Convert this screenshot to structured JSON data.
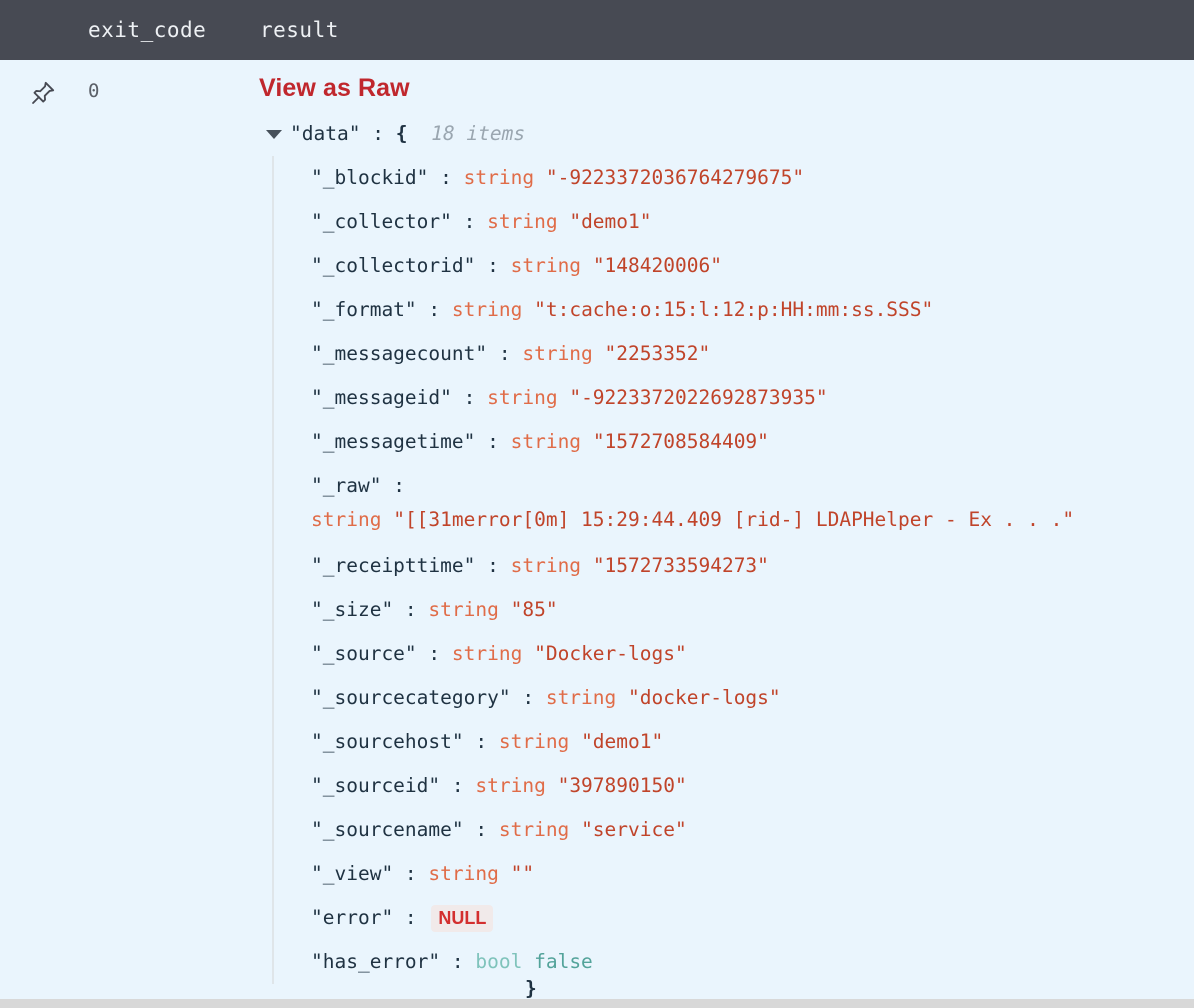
{
  "table": {
    "columns": [
      {
        "key": "pin",
        "label": ""
      },
      {
        "key": "exit_code",
        "label": "exit_code"
      },
      {
        "key": "result",
        "label": "result"
      }
    ],
    "row": {
      "pin_icon": "pushpin-icon",
      "exit_code": "0"
    }
  },
  "result": {
    "view_raw_label": "View as Raw",
    "root": {
      "key": "\"data\"",
      "colon": ":",
      "open_brace": "{",
      "count": "18 items",
      "close_brace": "}"
    },
    "fields": [
      {
        "key": "\"_blockid\"",
        "type": "string",
        "value": "\"-9223372036764279675\""
      },
      {
        "key": "\"_collector\"",
        "type": "string",
        "value": "\"demo1\""
      },
      {
        "key": "\"_collectorid\"",
        "type": "string",
        "value": "\"148420006\""
      },
      {
        "key": "\"_format\"",
        "type": "string",
        "value": "\"t:cache:o:15:l:12:p:HH:mm:ss.SSS\""
      },
      {
        "key": "\"_messagecount\"",
        "type": "string",
        "value": "\"2253352\""
      },
      {
        "key": "\"_messageid\"",
        "type": "string",
        "value": "\"-9223372022692873935\""
      },
      {
        "key": "\"_messagetime\"",
        "type": "string",
        "value": "\"1572708584409\""
      },
      {
        "key": "\"_raw\"",
        "type": "string",
        "value": "\"[[31merror[0m] 15:29:44.409 [rid-] LDAPHelper - Ex  . . .\""
      },
      {
        "key": "\"_receipttime\"",
        "type": "string",
        "value": "\"1572733594273\""
      },
      {
        "key": "\"_size\"",
        "type": "string",
        "value": "\"85\""
      },
      {
        "key": "\"_source\"",
        "type": "string",
        "value": "\"Docker-logs\""
      },
      {
        "key": "\"_sourcecategory\"",
        "type": "string",
        "value": "\"docker-logs\""
      },
      {
        "key": "\"_sourcehost\"",
        "type": "string",
        "value": "\"demo1\""
      },
      {
        "key": "\"_sourceid\"",
        "type": "string",
        "value": "\"397890150\""
      },
      {
        "key": "\"_sourcename\"",
        "type": "string",
        "value": "\"service\""
      },
      {
        "key": "\"_view\"",
        "type": "string",
        "value": "\"\""
      },
      {
        "key": "\"error\"",
        "type": "null",
        "value": "NULL"
      },
      {
        "key": "\"has_error\"",
        "type": "bool",
        "value": "false"
      }
    ]
  },
  "colors": {
    "header_bg": "#474a53",
    "body_bg": "#eaf5fd",
    "link_red": "#c0272d",
    "key_text": "#1f3242",
    "type_orange": "#e06c48",
    "value_red": "#c0442a",
    "bool_teal": "#53a39a",
    "null_red": "#d32f2f",
    "count_grey": "#9aa6b0"
  }
}
